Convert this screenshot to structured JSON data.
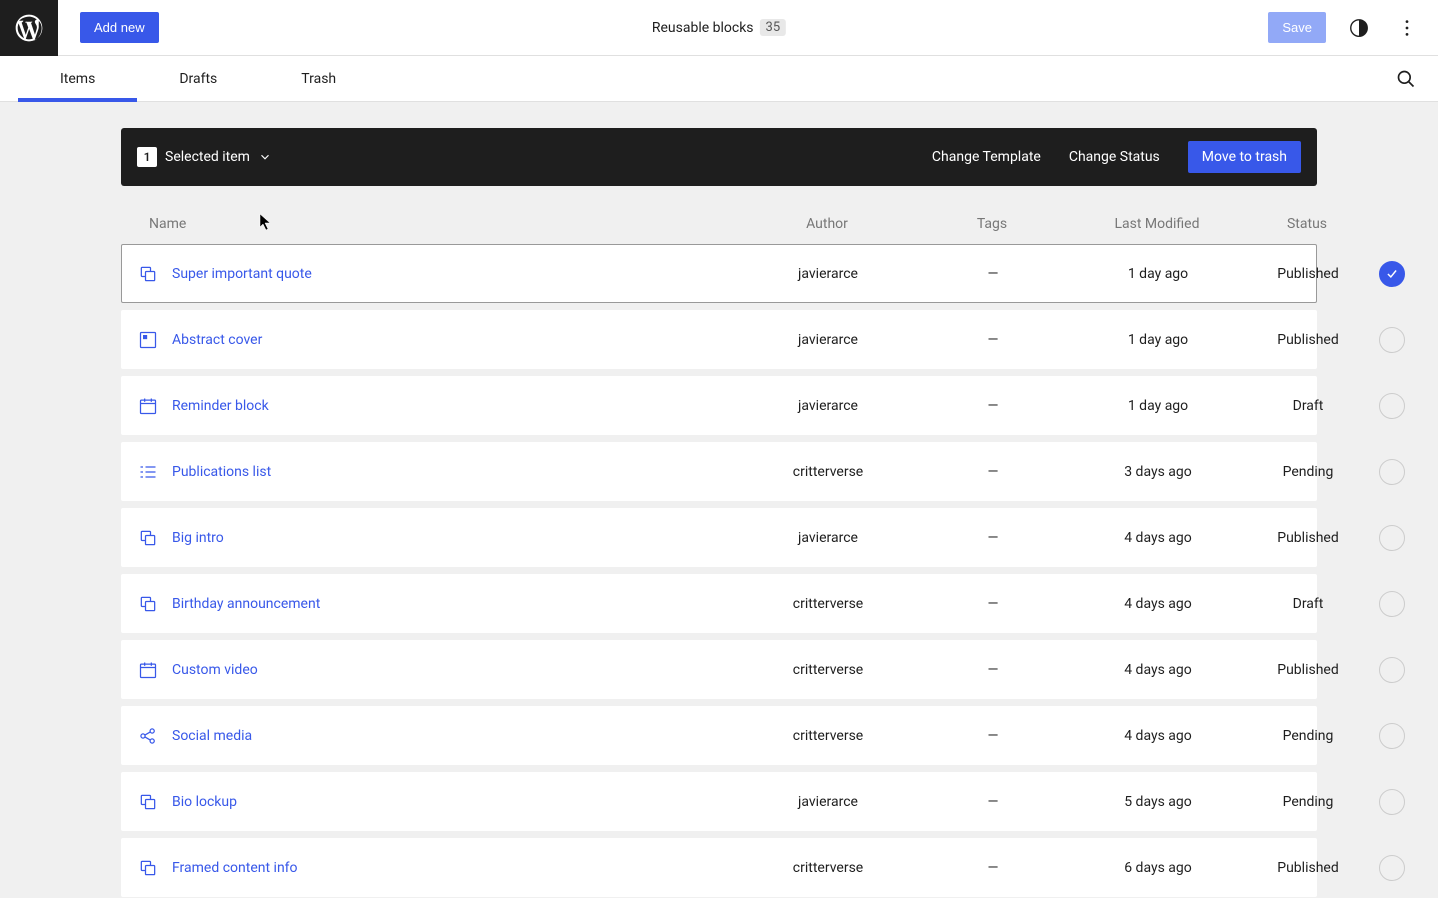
{
  "topbar": {
    "add_new": "Add new",
    "title": "Reusable blocks",
    "count": "35",
    "save": "Save"
  },
  "tabs": [
    {
      "label": "Items",
      "active": true
    },
    {
      "label": "Drafts",
      "active": false
    },
    {
      "label": "Trash",
      "active": false
    }
  ],
  "selection_bar": {
    "count": "1",
    "label": "Selected item",
    "actions": {
      "change_template": "Change Template",
      "change_status": "Change Status",
      "move_to_trash": "Move to trash"
    }
  },
  "columns": {
    "name": "Name",
    "author": "Author",
    "tags": "Tags",
    "last_modified": "Last Modified",
    "status": "Status"
  },
  "rows": [
    {
      "icon": "copy",
      "name": "Super important quote",
      "author": "javierarce",
      "tags": "—",
      "last_modified": "1 day ago",
      "status": "Published",
      "selected": true
    },
    {
      "icon": "square",
      "name": "Abstract cover",
      "author": "javierarce",
      "tags": "—",
      "last_modified": "1 day ago",
      "status": "Published",
      "selected": false
    },
    {
      "icon": "calendar",
      "name": "Reminder block",
      "author": "javierarce",
      "tags": "—",
      "last_modified": "1 day ago",
      "status": "Draft",
      "selected": false
    },
    {
      "icon": "list",
      "name": "Publications list",
      "author": "critterverse",
      "tags": "—",
      "last_modified": "3 days ago",
      "status": "Pending",
      "selected": false
    },
    {
      "icon": "copy",
      "name": "Big intro",
      "author": "javierarce",
      "tags": "—",
      "last_modified": "4 days ago",
      "status": "Published",
      "selected": false
    },
    {
      "icon": "copy",
      "name": "Birthday announcement",
      "author": "critterverse",
      "tags": "—",
      "last_modified": "4 days ago",
      "status": "Draft",
      "selected": false
    },
    {
      "icon": "calendar",
      "name": "Custom video",
      "author": "critterverse",
      "tags": "—",
      "last_modified": "4 days ago",
      "status": "Published",
      "selected": false
    },
    {
      "icon": "share",
      "name": "Social media",
      "author": "critterverse",
      "tags": "—",
      "last_modified": "4 days ago",
      "status": "Pending",
      "selected": false
    },
    {
      "icon": "copy",
      "name": "Bio lockup",
      "author": "javierarce",
      "tags": "—",
      "last_modified": "5 days ago",
      "status": "Pending",
      "selected": false
    },
    {
      "icon": "copy",
      "name": "Framed content info",
      "author": "critterverse",
      "tags": "—",
      "last_modified": "6 days ago",
      "status": "Published",
      "selected": false
    }
  ]
}
